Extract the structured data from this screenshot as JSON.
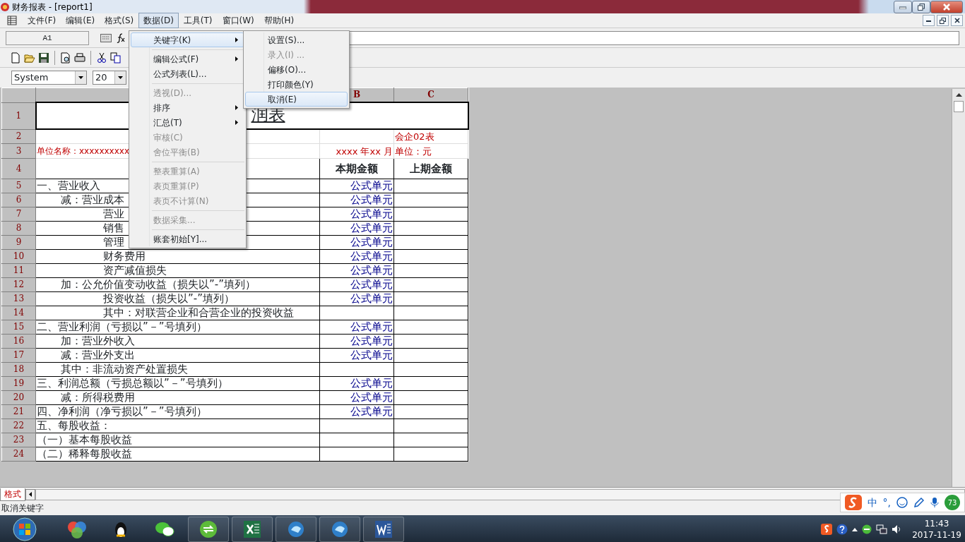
{
  "window": {
    "title": "财务报表 - [report1]"
  },
  "menubar": [
    {
      "label": "文件(F)",
      "selected": false
    },
    {
      "label": "编辑(E)",
      "selected": false
    },
    {
      "label": "格式(S)",
      "selected": false
    },
    {
      "label": "数据(D)",
      "selected": true
    },
    {
      "label": "工具(T)",
      "selected": false
    },
    {
      "label": "窗口(W)",
      "selected": false
    },
    {
      "label": "帮助(H)",
      "selected": false
    }
  ],
  "formula_bar": {
    "cell_ref": "A1"
  },
  "format_bar": {
    "font": "System",
    "size": "20"
  },
  "data_menu": [
    {
      "kind": "submenu",
      "label": "关键字(K)",
      "disabled": false,
      "highlighted": true
    },
    {
      "kind": "separator"
    },
    {
      "kind": "submenu",
      "label": "编辑公式(F)",
      "disabled": false,
      "highlighted": false
    },
    {
      "kind": "command",
      "label": "公式列表(L)...",
      "disabled": false,
      "highlighted": false
    },
    {
      "kind": "separator"
    },
    {
      "kind": "command",
      "label": "透视(D)...",
      "disabled": true,
      "highlighted": false
    },
    {
      "kind": "submenu",
      "label": "排序",
      "disabled": false,
      "highlighted": false
    },
    {
      "kind": "submenu",
      "label": "汇总(T)",
      "disabled": false,
      "highlighted": false
    },
    {
      "kind": "command",
      "label": "审核(C)",
      "disabled": true,
      "highlighted": false
    },
    {
      "kind": "command",
      "label": "舍位平衡(B)",
      "disabled": true,
      "highlighted": false
    },
    {
      "kind": "separator"
    },
    {
      "kind": "command",
      "label": "整表重算(A)",
      "disabled": true,
      "highlighted": false
    },
    {
      "kind": "command",
      "label": "表页重算(P)",
      "disabled": true,
      "highlighted": false
    },
    {
      "kind": "command",
      "label": "表页不计算(N)",
      "disabled": true,
      "highlighted": false
    },
    {
      "kind": "separator"
    },
    {
      "kind": "command",
      "label": "数据采集...",
      "disabled": true,
      "highlighted": false
    },
    {
      "kind": "separator"
    },
    {
      "kind": "command",
      "label": "账套初始[Y]...",
      "disabled": false,
      "highlighted": false
    }
  ],
  "keyword_submenu": [
    {
      "label": "设置(S)...",
      "disabled": false,
      "highlighted": false
    },
    {
      "label": "录入(I) ...",
      "disabled": true,
      "highlighted": false
    },
    {
      "label": "偏移(O)...",
      "disabled": false,
      "highlighted": false
    },
    {
      "label": "打印颜色(Y)",
      "disabled": false,
      "highlighted": false
    },
    {
      "label": "取消(E)",
      "disabled": false,
      "highlighted": true
    }
  ],
  "sheet": {
    "columns": [
      "B",
      "C"
    ],
    "rows": [
      {
        "num": "1",
        "kind": "title",
        "a": "润表"
      },
      {
        "num": "2",
        "kind": "meta",
        "c": "会企02表"
      },
      {
        "num": "3",
        "kind": "meta",
        "a": "单位名称：xxxxxxxxxx",
        "b": "xxxx 年xx 月",
        "c": "单位：元"
      },
      {
        "num": "4",
        "kind": "header",
        "b": "本期金额",
        "c": "上期金额"
      },
      {
        "num": "5",
        "kind": "top",
        "a": "一、营业收入",
        "b": "公式单元"
      },
      {
        "num": "6",
        "kind": "sub",
        "a": "减：营业成本",
        "b": "公式单元"
      },
      {
        "num": "7",
        "kind": "detail",
        "a": "营业",
        "b": "公式单元"
      },
      {
        "num": "8",
        "kind": "detail",
        "a": "销售",
        "b": "公式单元"
      },
      {
        "num": "9",
        "kind": "detail",
        "a": "管理",
        "b": "公式单元"
      },
      {
        "num": "10",
        "kind": "detail",
        "a": "财务费用",
        "b": "公式单元"
      },
      {
        "num": "11",
        "kind": "detail",
        "a": "资产减值损失",
        "b": "公式单元"
      },
      {
        "num": "12",
        "kind": "sub",
        "a": "加：公允价值变动收益（损失以”-”填列）",
        "b": "公式单元"
      },
      {
        "num": "13",
        "kind": "detail",
        "a": "投资收益（损失以”-”填列）",
        "b": "公式单元"
      },
      {
        "num": "14",
        "kind": "detail",
        "a": "其中：对联营企业和合营企业的投资收益"
      },
      {
        "num": "15",
        "kind": "top",
        "a": "二、营业利润（亏损以”－”号填列）",
        "b": "公式单元"
      },
      {
        "num": "16",
        "kind": "sub",
        "a": "加：营业外收入",
        "b": "公式单元"
      },
      {
        "num": "17",
        "kind": "sub",
        "a": "减：营业外支出",
        "b": "公式单元"
      },
      {
        "num": "18",
        "kind": "sub",
        "a": "其中：非流动资产处置损失"
      },
      {
        "num": "19",
        "kind": "top",
        "a": "三、利润总额（亏损总额以”－”号填列）",
        "b": "公式单元"
      },
      {
        "num": "20",
        "kind": "sub",
        "a": "减：所得税费用",
        "b": "公式单元"
      },
      {
        "num": "21",
        "kind": "top",
        "a": "四、净利润（净亏损以”－”号填列）",
        "b": "公式单元"
      },
      {
        "num": "22",
        "kind": "top",
        "a": "五、每股收益："
      },
      {
        "num": "23",
        "kind": "top",
        "a": "（一）基本每股收益"
      },
      {
        "num": "24",
        "kind": "top",
        "a": "（二）稀释每股收益"
      }
    ]
  },
  "sheet_tabs": [
    {
      "label": "格式",
      "selected": true
    }
  ],
  "status_bar": "取消关键字",
  "ime": {
    "mode": "中",
    "punct": "°,",
    "badge": "73"
  },
  "clock": {
    "time": "11:43",
    "date": "2017-11-19"
  }
}
